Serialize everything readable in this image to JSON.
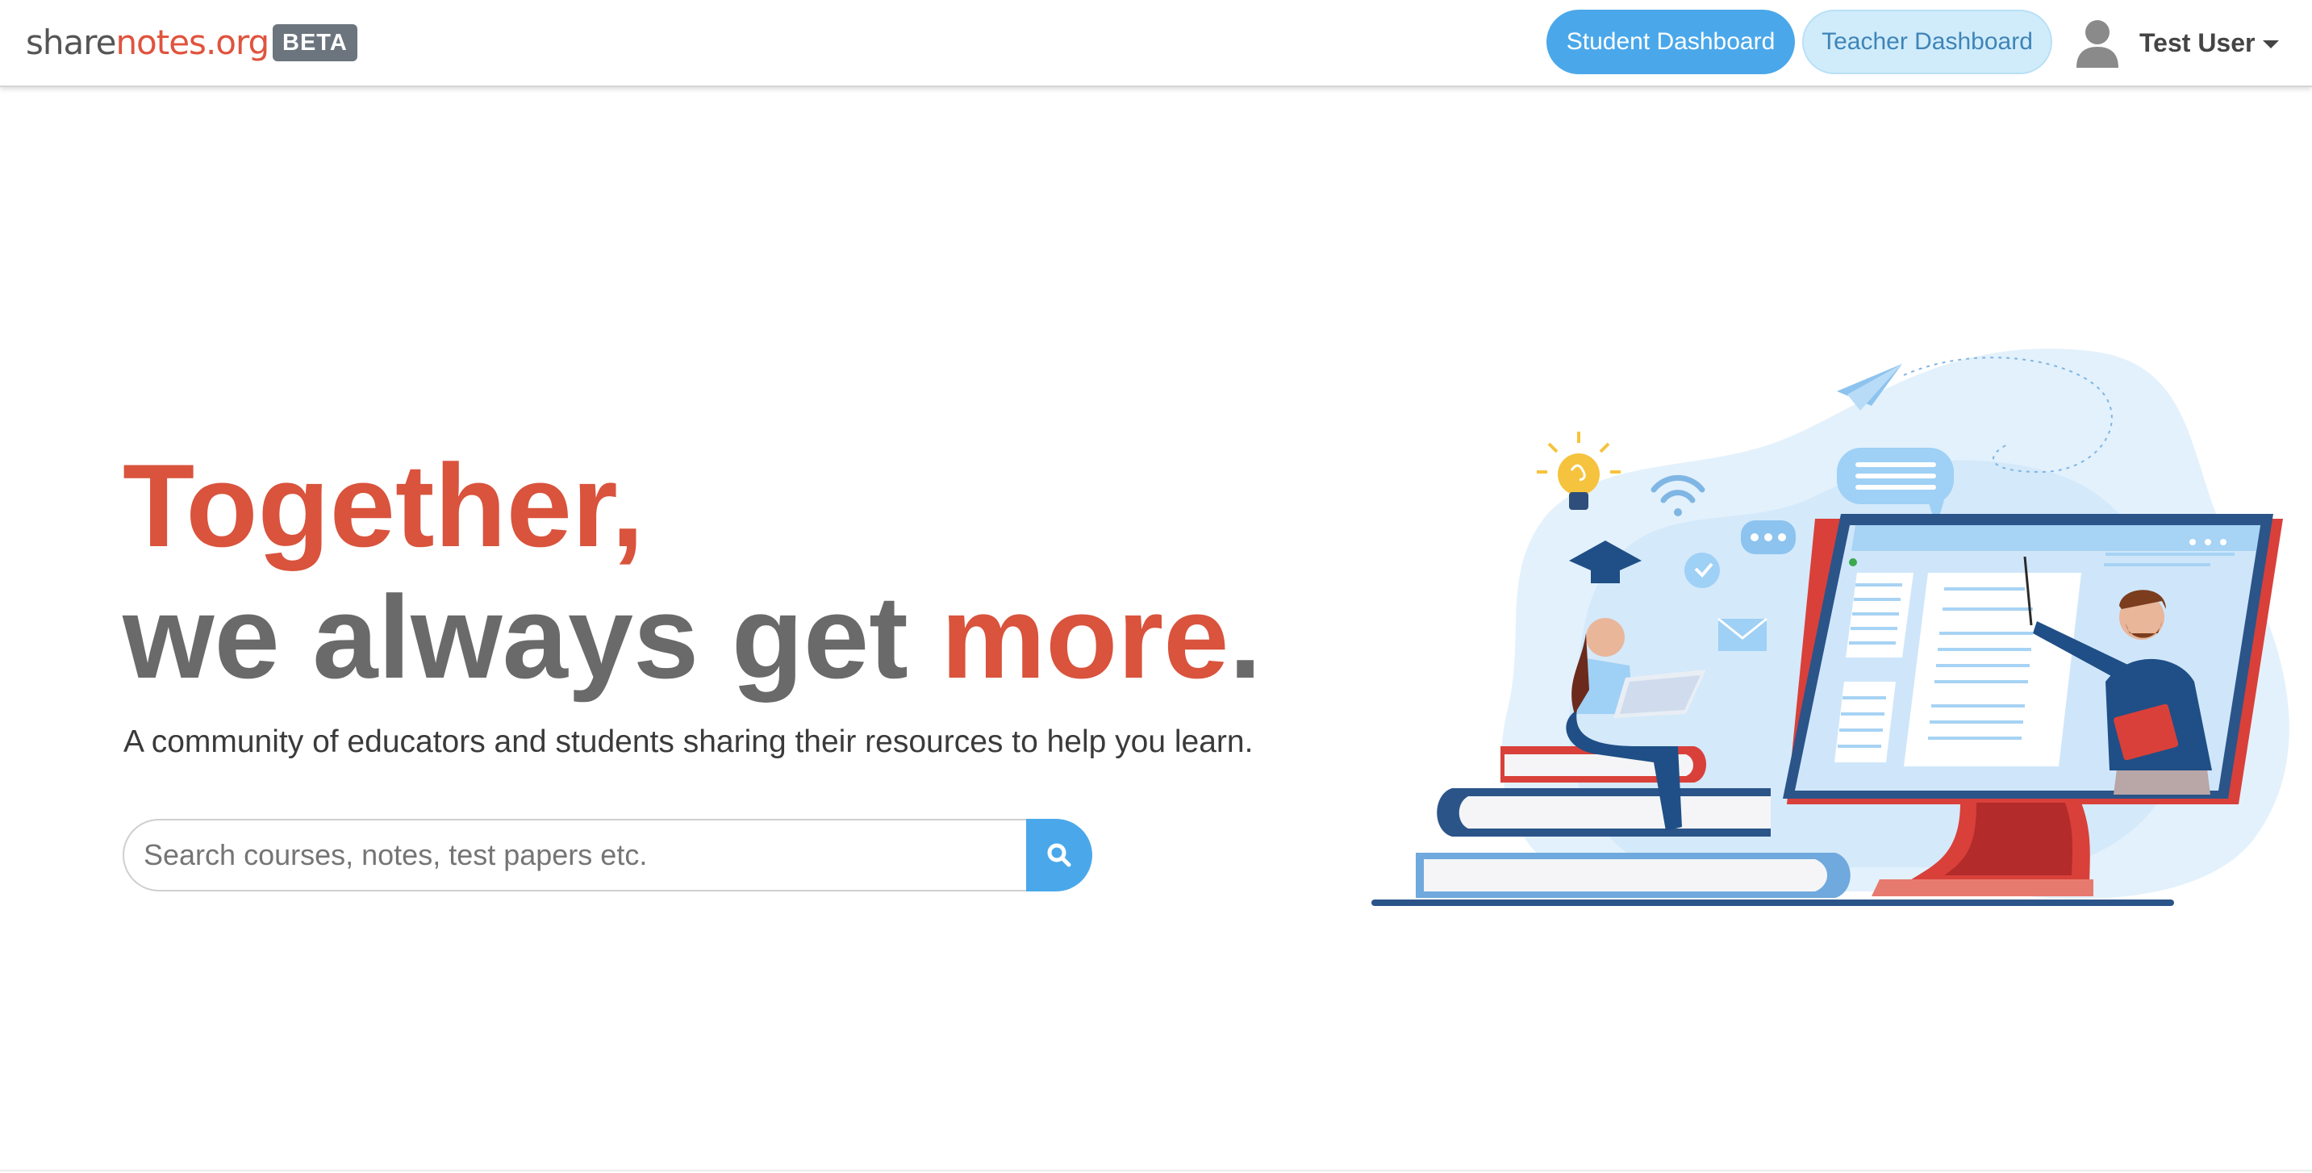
{
  "navbar": {
    "brand_part1": "share",
    "brand_part2": "notes.org",
    "beta_label": "BETA",
    "student_dashboard_label": "Student Dashboard",
    "teacher_dashboard_label": "Teacher Dashboard",
    "user_name": "Test User"
  },
  "hero": {
    "headline_line1": "Together,",
    "headline_line2_start": "we always get ",
    "headline_line2_accent": "more",
    "headline_line2_end": ".",
    "subtitle": "A community of educators and students sharing their resources to help you learn.",
    "search": {
      "placeholder": "Search courses, notes, test papers etc.",
      "value": ""
    }
  },
  "icons": {
    "search": "search-icon",
    "avatar": "user-avatar-icon",
    "dropdown": "chevron-down-icon"
  },
  "colors": {
    "accent_red": "#d9533d",
    "primary_blue": "#4aa8ea",
    "light_blue": "#d0ecfb",
    "heading_gray": "#6a6a6a"
  }
}
